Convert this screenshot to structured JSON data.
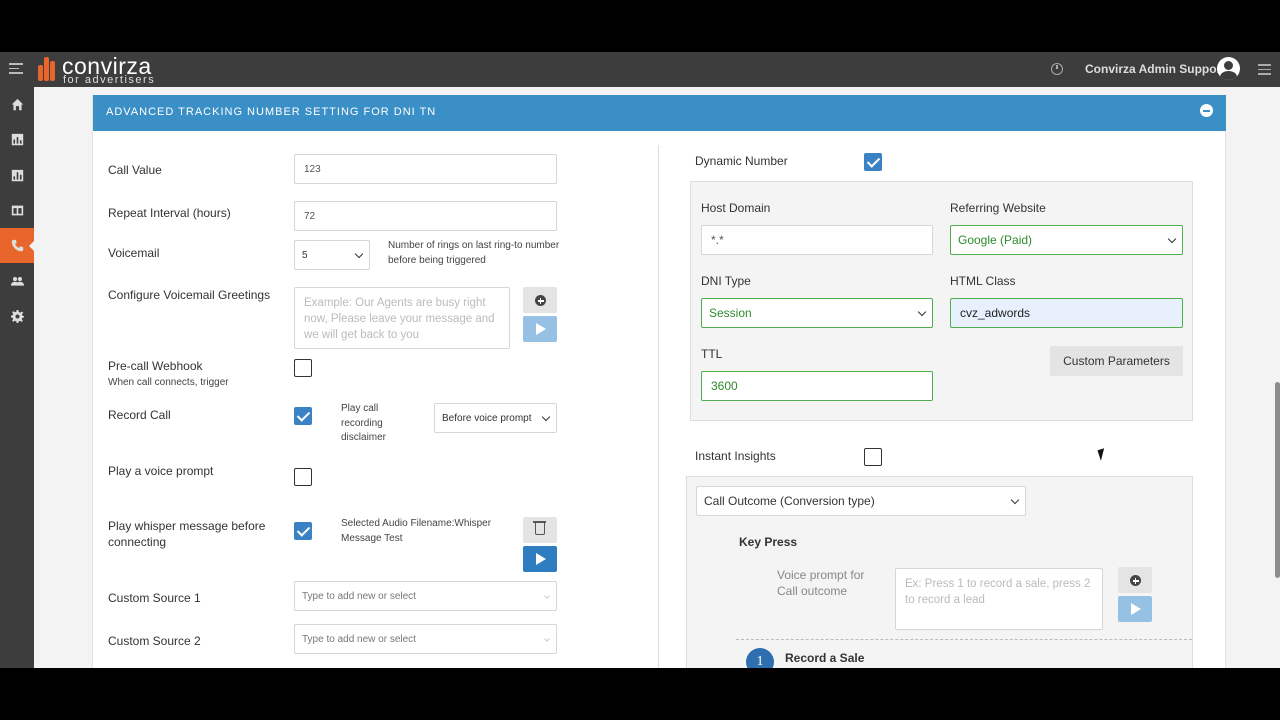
{
  "app": {
    "logo_text": "convirza",
    "logo_sub": "for advertisers",
    "user_name": "Convirza Admin Support",
    "brand_color": "#e8652b",
    "accent_color": "#3a8fc7"
  },
  "sidebar": {
    "items": [
      {
        "icon": "home-icon"
      },
      {
        "icon": "bar-chart-icon"
      },
      {
        "icon": "report-chart-icon"
      },
      {
        "icon": "layout-icon"
      },
      {
        "icon": "phone-icon",
        "active": true
      },
      {
        "icon": "users-icon"
      },
      {
        "icon": "gear-icon"
      }
    ]
  },
  "panel": {
    "title": "ADVANCED TRACKING NUMBER SETTING FOR DNI TN"
  },
  "left": {
    "call_value_label": "Call Value",
    "call_value": "123",
    "repeat_interval_label": "Repeat Interval (hours)",
    "repeat_interval": "72",
    "voicemail_label": "Voicemail",
    "voicemail_rings": "5",
    "voicemail_note": "Number of rings on last ring-to number before being triggered",
    "greetings_label": "Configure Voicemail Greetings",
    "greetings_placeholder": "Example: Our Agents are busy right now, Please leave your message and we will get back to you",
    "precall_label": "Pre-call Webhook",
    "precall_sub": "When call connects, trigger",
    "precall_checked": false,
    "record_label": "Record Call",
    "record_checked": true,
    "disclaimer_label": "Play call recording disclaimer",
    "disclaimer_option": "Before voice prompt",
    "voice_prompt_label": "Play a voice prompt",
    "voice_prompt_checked": false,
    "whisper_label": "Play whisper message before connecting",
    "whisper_checked": true,
    "whisper_file": "Selected Audio Filename:Whisper Message Test",
    "custom_source_1_label": "Custom Source 1",
    "custom_source_1_placeholder": "Type to add new or select",
    "custom_source_2_label": "Custom Source 2",
    "custom_source_2_placeholder": "Type to add new or select"
  },
  "right": {
    "dynamic_number_label": "Dynamic Number",
    "dynamic_number_checked": true,
    "host_domain_label": "Host Domain",
    "host_domain": "*.*",
    "referring_label": "Referring Website",
    "referring_value": "Google (Paid)",
    "dni_type_label": "DNI Type",
    "dni_type_value": "Session",
    "html_class_label": "HTML Class",
    "html_class_value": "cvz_adwords",
    "ttl_label": "TTL",
    "ttl_value": "3600",
    "custom_params_label": "Custom Parameters",
    "instant_insights_label": "Instant Insights",
    "instant_insights_checked": false,
    "call_outcome_value": "Call Outcome (Conversion type)",
    "key_press_label": "Key Press",
    "voice_prompt_outcome_label": "Voice prompt for Call outcome",
    "voice_prompt_outcome_placeholder": "Ex: Press 1 to record a sale, press 2 to record a lead",
    "step_number": "1",
    "record_sale_label": "Record a Sale"
  }
}
